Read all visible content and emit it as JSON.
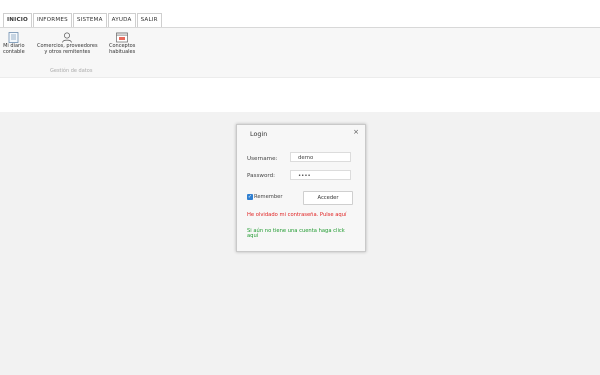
{
  "tabs": [
    {
      "label": "INICIO",
      "active": true
    },
    {
      "label": "INFORMES",
      "active": false
    },
    {
      "label": "SISTEMA",
      "active": false
    },
    {
      "label": "AYUDA",
      "active": false
    },
    {
      "label": "SALIR",
      "active": false
    }
  ],
  "ribbon": {
    "items": [
      {
        "label_1": "Mi diario",
        "label_2": "contable",
        "icon": "journal-icon"
      },
      {
        "label_1": "Comercios, proveedores",
        "label_2": "y otros remitentes",
        "icon": "user-icon"
      },
      {
        "label_1": "Conceptos",
        "label_2": "habituales",
        "icon": "concepts-icon"
      }
    ],
    "group_label": "Gestión de datos"
  },
  "login": {
    "title": "Login",
    "close": "×",
    "username_label": "Username:",
    "username_value": "demo",
    "password_label": "Password:",
    "password_value": "••••",
    "remember_label": "Remember",
    "remember_checked": true,
    "submit_label": "Acceder",
    "forgot_link": "He olvidado mi contraseña. Pulse aquí",
    "register_link": "Si aún no tiene una cuenta haga click aquí"
  },
  "colors": {
    "accent": "#2f7fd1",
    "link_red": "#e02020",
    "link_green": "#1e9a2e"
  }
}
